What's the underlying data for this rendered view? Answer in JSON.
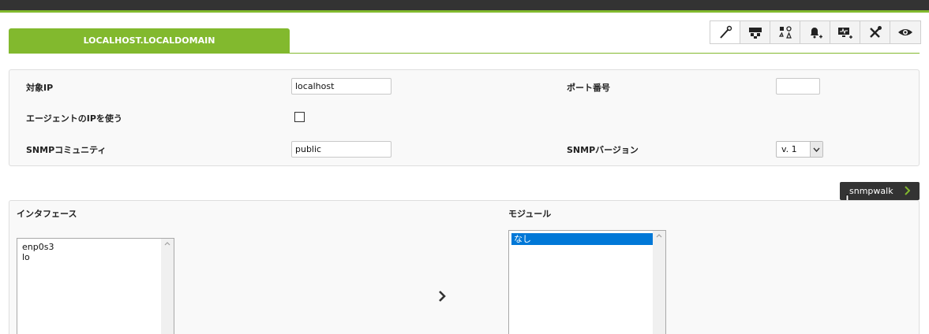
{
  "header": {
    "host_tab": "LOCALHOST.LOCALDOMAIN",
    "accent_color": "#82b92e",
    "topbar_color": "#333333"
  },
  "toolbar": {
    "icons": [
      "wand-icon",
      "network-icon",
      "shapes-icon",
      "bell-add-icon",
      "monitor-add-icon",
      "tools-icon",
      "eye-icon"
    ],
    "active_index": 0
  },
  "form": {
    "target_ip_label": "対象IP",
    "target_ip_value": "localhost",
    "port_label": "ポート番号",
    "port_value": "",
    "use_agent_ip_label": "エージェントのIPを使う",
    "use_agent_ip_checked": false,
    "community_label": "SNMPコミュニティ",
    "community_value": "public",
    "version_label": "SNMPバージョン",
    "version_value": "v. 1"
  },
  "actions": {
    "snmpwalk_label": "snmpwalk"
  },
  "interfaces": {
    "label": "インタフェース",
    "items": [
      "enp0s3",
      "lo"
    ]
  },
  "modules": {
    "label": "モジュール",
    "items": [
      "なし"
    ],
    "selected_index": 0
  }
}
